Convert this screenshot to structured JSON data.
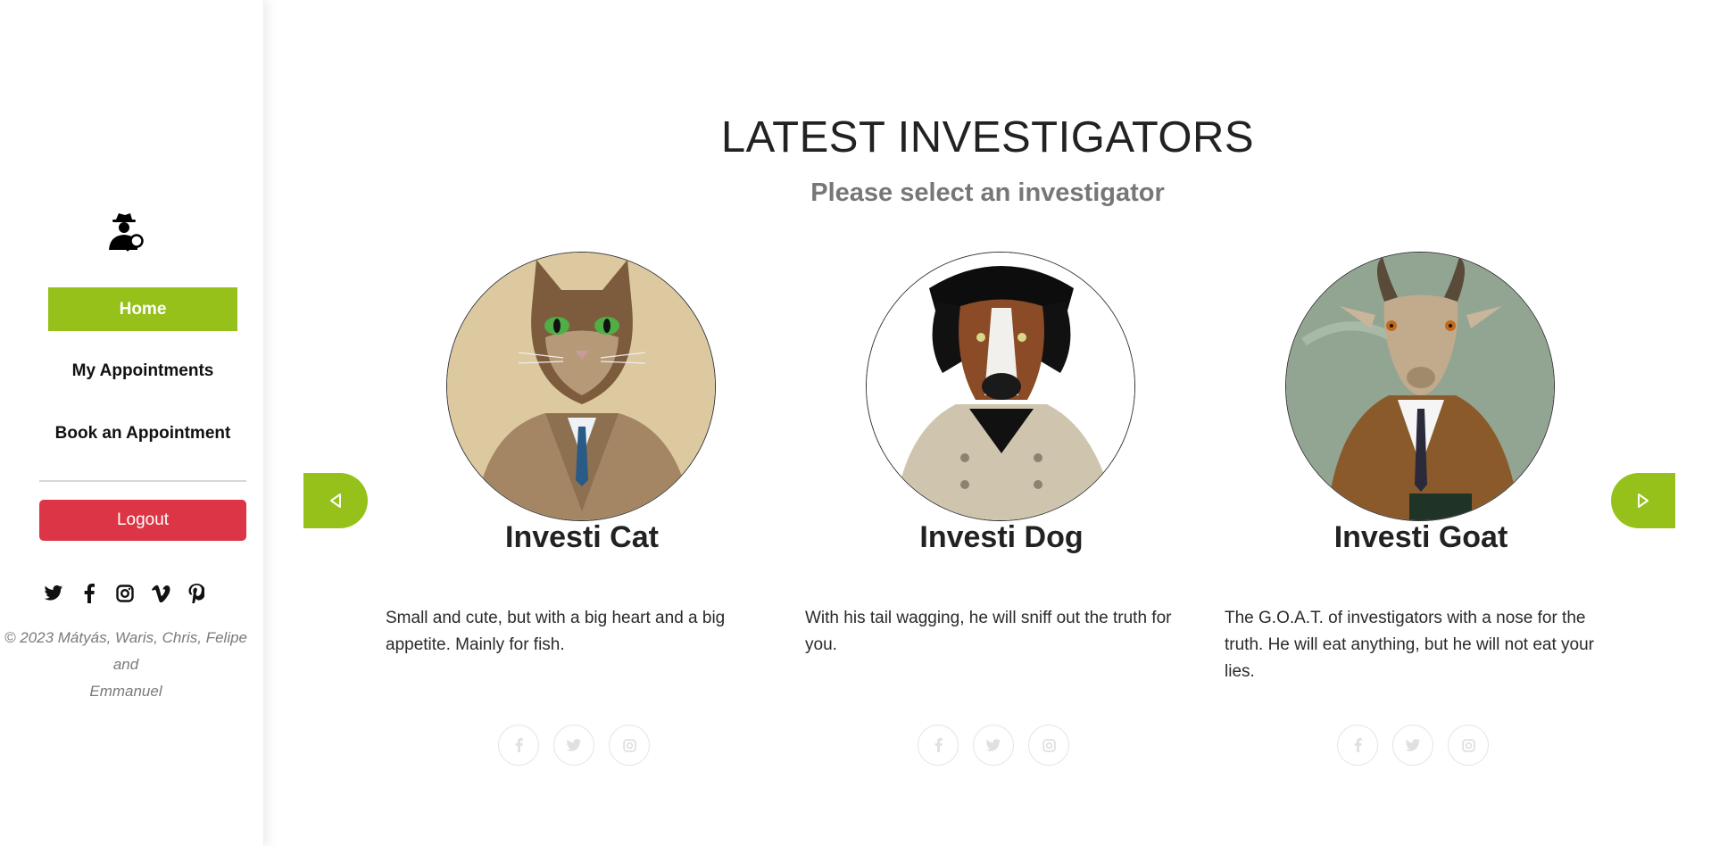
{
  "sidebar": {
    "logo_icon": "detective-icon",
    "nav": {
      "home": "Home",
      "appointments": "My Appointments",
      "book": "Book an Appointment"
    },
    "logout": "Logout",
    "social_icons": [
      "twitter-icon",
      "facebook-icon",
      "instagram-icon",
      "vimeo-icon",
      "pinterest-icon"
    ],
    "copyright_line1": "© 2023 Mátyás, Waris, Chris, Felipe and",
    "copyright_line2": "Emmanuel"
  },
  "main": {
    "title": "LATEST INVESTIGATORS",
    "subtitle": "Please select an investigator",
    "investigators": [
      {
        "name": "Investi Cat",
        "description": "Small and cute, but with a big heart and a big appetite. Mainly for fish."
      },
      {
        "name": "Investi Dog",
        "description": "With his tail wagging, he will sniff out the truth for you."
      },
      {
        "name": "Investi Goat",
        "description": "The G.O.A.T. of investigators with a nose for the truth. He will eat anything, but he will not eat your lies."
      }
    ],
    "card_social_icons": [
      "facebook-icon",
      "twitter-icon",
      "instagram-icon"
    ]
  },
  "colors": {
    "accent_green": "#95c11a",
    "logout_red": "#dc3545",
    "muted_text": "#777777"
  }
}
